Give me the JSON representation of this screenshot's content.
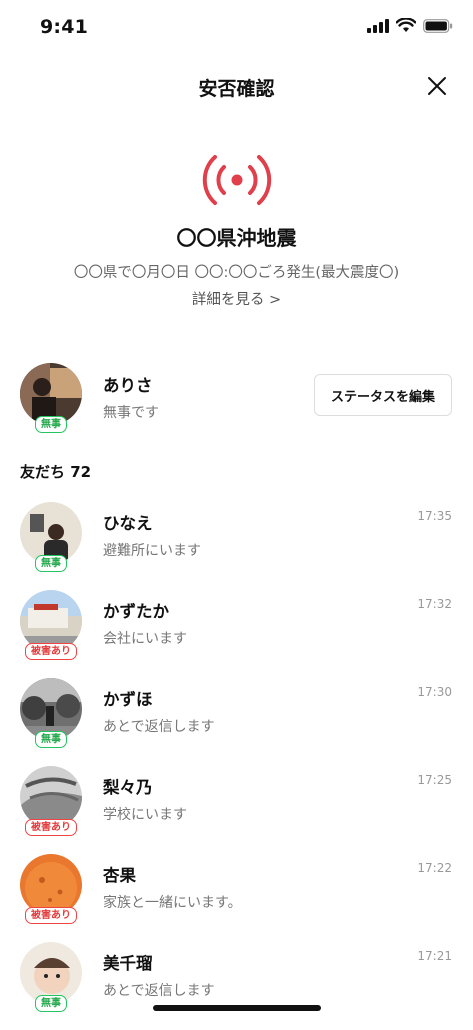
{
  "status": {
    "time": "9:41"
  },
  "header": {
    "title": "安否確認"
  },
  "alert": {
    "title": "〇〇県沖地震",
    "detail": "〇〇県で〇月〇日 〇〇:〇〇ごろ発生(最大震度〇)",
    "link": "詳細を見る >"
  },
  "me": {
    "name": "ありさ",
    "status": "無事です",
    "badge": "無事",
    "edit_label": "ステータスを編集"
  },
  "friends_header": "友だち 72",
  "friends": [
    {
      "name": "ひなえ",
      "status": "避難所にいます",
      "time": "17:35",
      "badge": "無事",
      "badge_type": "safe"
    },
    {
      "name": "かずたか",
      "status": "会社にいます",
      "time": "17:32",
      "badge": "被害あり",
      "badge_type": "harm"
    },
    {
      "name": "かずほ",
      "status": "あとで返信します",
      "time": "17:30",
      "badge": "無事",
      "badge_type": "safe"
    },
    {
      "name": "梨々乃",
      "status": "学校にいます",
      "time": "17:25",
      "badge": "被害あり",
      "badge_type": "harm"
    },
    {
      "name": "杏果",
      "status": "家族と一緒にいます。",
      "time": "17:22",
      "badge": "被害あり",
      "badge_type": "harm"
    },
    {
      "name": "美千瑠",
      "status": "あとで返信します",
      "time": "17:21",
      "badge": "無事",
      "badge_type": "safe"
    }
  ],
  "colors": {
    "alert_red": "#e0404b",
    "safe_green": "#22c55e",
    "harm_red": "#ef4444"
  }
}
